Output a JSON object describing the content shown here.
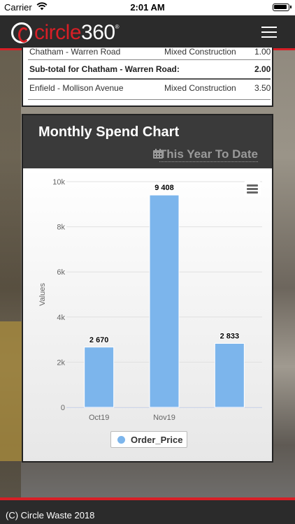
{
  "status_bar": {
    "carrier": "Carrier",
    "time": "2:01 AM"
  },
  "header": {
    "logo_word": "circle",
    "logo_number": "360",
    "logo_mark": "®"
  },
  "table": {
    "rows": [
      {
        "site": "Chatham - Warren Road",
        "type": "Mixed Construction",
        "amount": "1.00"
      },
      {
        "site": "Sub-total for Chatham - Warren Road:",
        "type": "",
        "amount": "2.00"
      },
      {
        "site": "Enfield - Mollison Avenue",
        "type": "Mixed Construction",
        "amount": "3.50"
      }
    ]
  },
  "chart_card": {
    "title": "Monthly Spend Chart",
    "period": "This Year To Date"
  },
  "chart_data": {
    "type": "bar",
    "categories": [
      "Oct19",
      "Nov19",
      ""
    ],
    "series": [
      {
        "name": "Order_Price",
        "values": [
          2670,
          9408,
          2833
        ]
      }
    ],
    "data_labels": [
      "2 670",
      "9 408",
      "2 833"
    ],
    "ylabel": "Values",
    "ylim": [
      0,
      10000
    ],
    "yticks": [
      "0",
      "2k",
      "4k",
      "6k",
      "8k",
      "10k"
    ],
    "color": "#7cb5ec",
    "legend": "bottom-center",
    "grid": true
  },
  "footer": {
    "copyright": "(C) Circle Waste 2018"
  },
  "colors": {
    "brand_red": "#d81f26",
    "header_dark": "#2b2b2b",
    "bar_blue": "#7cb5ec"
  }
}
